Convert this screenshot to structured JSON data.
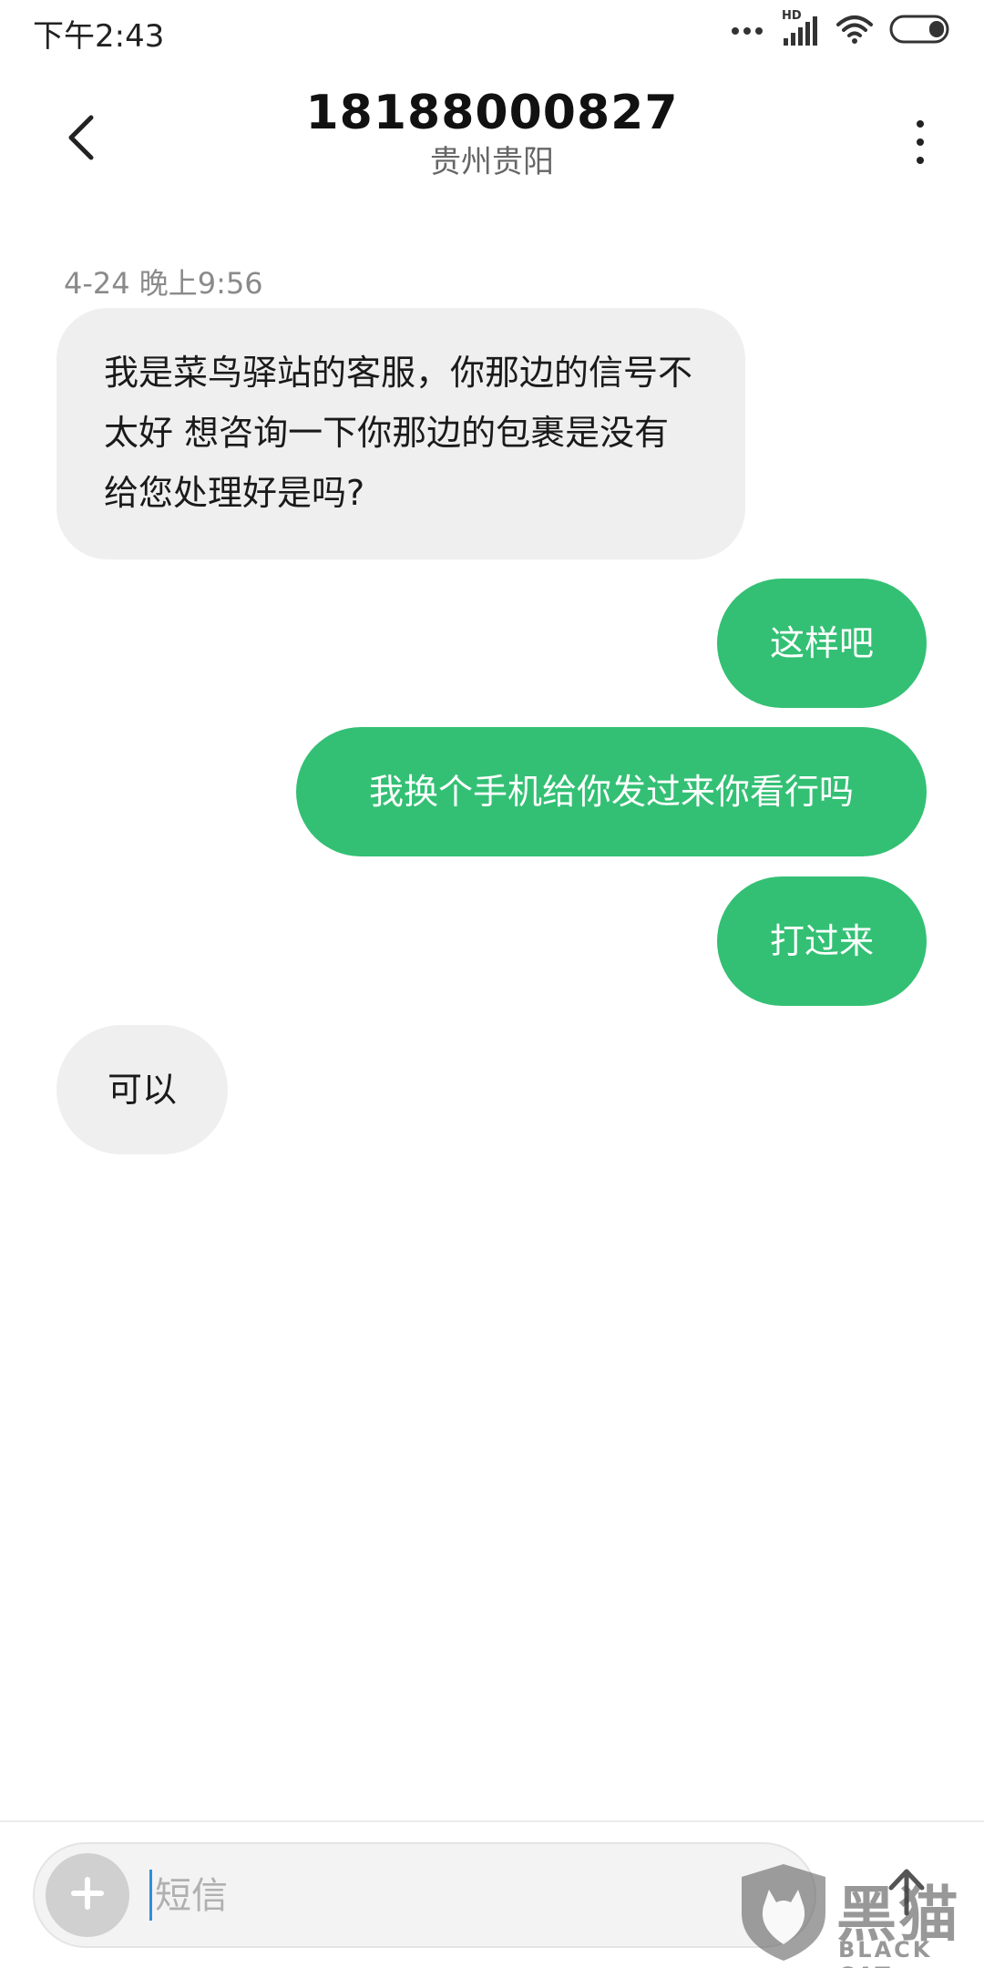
{
  "status_bar": {
    "time": "下午2:43",
    "network_label": "HD",
    "icons": [
      "dots-icon",
      "signal-icon",
      "wifi-icon",
      "battery-icon"
    ]
  },
  "header": {
    "title": "18188000827",
    "subtitle": "贵州贵阳"
  },
  "conversation": {
    "timestamp": "4-24 晚上9:56",
    "messages": [
      {
        "direction": "incoming",
        "text": "我是菜鸟驿站的客服，你那边的信号不太好 想咨询一下你那边的包裹是没有给您处理好是吗?"
      },
      {
        "direction": "outgoing",
        "text": "这样吧"
      },
      {
        "direction": "outgoing",
        "text": "我换个手机给你发过来你看行吗"
      },
      {
        "direction": "outgoing",
        "text": "打过来"
      },
      {
        "direction": "incoming",
        "text": "可以"
      }
    ]
  },
  "composer": {
    "placeholder": "短信"
  },
  "watermark": {
    "cn": "黑猫",
    "en": "BLACK CAT"
  },
  "colors": {
    "outgoing_bubble": "#33c074",
    "incoming_bubble": "#efefef",
    "caret": "#2f8fd6"
  }
}
